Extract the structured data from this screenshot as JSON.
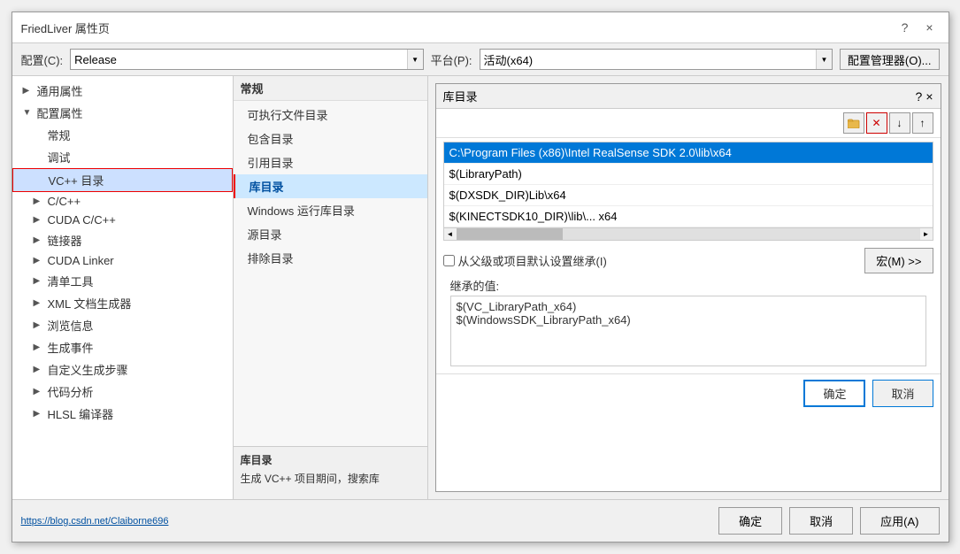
{
  "dialog": {
    "title": "FriedLiver 属性页",
    "close_label": "×",
    "help_label": "?"
  },
  "config_bar": {
    "config_label": "配置(C):",
    "config_value": "Release",
    "platform_label": "平台(P):",
    "platform_value": "活动(x64)",
    "manager_btn": "配置管理器(O)..."
  },
  "left_tree": {
    "items": [
      {
        "label": "通用属性",
        "indent": 0,
        "expandable": true,
        "expanded": false,
        "selected": false
      },
      {
        "label": "配置属性",
        "indent": 0,
        "expandable": true,
        "expanded": true,
        "selected": false
      },
      {
        "label": "常规",
        "indent": 1,
        "expandable": false,
        "expanded": false,
        "selected": false
      },
      {
        "label": "调试",
        "indent": 1,
        "expandable": false,
        "expanded": false,
        "selected": false
      },
      {
        "label": "VC++ 目录",
        "indent": 1,
        "expandable": false,
        "expanded": false,
        "selected": true
      },
      {
        "label": "C/C++",
        "indent": 1,
        "expandable": true,
        "expanded": false,
        "selected": false
      },
      {
        "label": "CUDA C/C++",
        "indent": 1,
        "expandable": true,
        "expanded": false,
        "selected": false
      },
      {
        "label": "链接器",
        "indent": 1,
        "expandable": true,
        "expanded": false,
        "selected": false
      },
      {
        "label": "CUDA Linker",
        "indent": 1,
        "expandable": true,
        "expanded": false,
        "selected": false
      },
      {
        "label": "清单工具",
        "indent": 1,
        "expandable": true,
        "expanded": false,
        "selected": false
      },
      {
        "label": "XML 文档生成器",
        "indent": 1,
        "expandable": true,
        "expanded": false,
        "selected": false
      },
      {
        "label": "浏览信息",
        "indent": 1,
        "expandable": true,
        "expanded": false,
        "selected": false
      },
      {
        "label": "生成事件",
        "indent": 1,
        "expandable": true,
        "expanded": false,
        "selected": false
      },
      {
        "label": "自定义生成步骤",
        "indent": 1,
        "expandable": true,
        "expanded": false,
        "selected": false
      },
      {
        "label": "代码分析",
        "indent": 1,
        "expandable": true,
        "expanded": false,
        "selected": false
      },
      {
        "label": "HLSL 编译器",
        "indent": 1,
        "expandable": true,
        "expanded": false,
        "selected": false
      }
    ]
  },
  "mid_panel": {
    "header": "常规",
    "items": [
      {
        "label": "可执行文件目录",
        "selected": false
      },
      {
        "label": "包含目录",
        "selected": false
      },
      {
        "label": "引用目录",
        "selected": false
      },
      {
        "label": "库目录",
        "selected": true
      },
      {
        "label": "Windows 运行库目录",
        "selected": false
      },
      {
        "label": "源目录",
        "selected": false
      },
      {
        "label": "排除目录",
        "selected": false
      }
    ],
    "desc_title": "库目录",
    "desc_text": "生成 VC++ 项目期间，搜索库"
  },
  "prop_dialog": {
    "title": "库目录",
    "help_label": "?",
    "close_label": "×",
    "toolbar": {
      "folder_btn": "📁",
      "delete_btn": "✕",
      "down_btn": "↓",
      "up_btn": "↑"
    },
    "list_items": [
      {
        "label": "C:\\Program Files (x86)\\Intel RealSense SDK 2.0\\lib\\x64",
        "highlighted": true
      },
      {
        "label": "$(LibraryPath)",
        "highlighted": false
      },
      {
        "label": "$(DXSDK_DIR)Lib\\x64",
        "highlighted": false
      },
      {
        "label": "$(KINECTSDK10_DIR)\\lib\\... x64",
        "highlighted": false
      }
    ],
    "inherit_label": "从父级或项目默认设置继承(I)",
    "macro_btn": "宏(M) >>",
    "inherited_title": "继承的值:",
    "inherited_values": [
      "$(VC_LibraryPath_x64)",
      "$(WindowsSDK_LibraryPath_x64)"
    ],
    "ok_btn": "确定",
    "cancel_btn": "取消"
  },
  "footer": {
    "ok_btn": "确定",
    "cancel_btn": "取消",
    "apply_btn": "应用(A)",
    "link_text": "https://blog.csdn.net/Claiborne696"
  }
}
